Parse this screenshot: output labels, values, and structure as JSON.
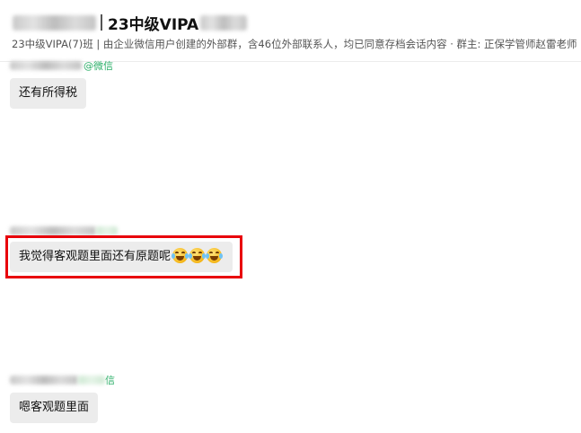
{
  "header": {
    "group_title": "23中级VIPA",
    "subtitle": "23中级VIPA(7)班 | 由企业微信用户创建的外部群，含46位外部联系人，均已同意存档会话内容 · 群主: 正保学管师赵雷老师"
  },
  "messages": [
    {
      "platform": "@微信",
      "text": "还有所得税"
    },
    {
      "platform": "",
      "text": "我觉得客观题里面还有原题呢",
      "emojis": [
        "grinning-sweat-icon",
        "grinning-sweat-icon",
        "grinning-sweat-icon"
      ]
    },
    {
      "platform": "信",
      "text": "嗯客观题里面"
    }
  ],
  "colors": {
    "highlight": "#e8000b",
    "bubble": "#ececec",
    "wechat_green": "#2aae67"
  }
}
